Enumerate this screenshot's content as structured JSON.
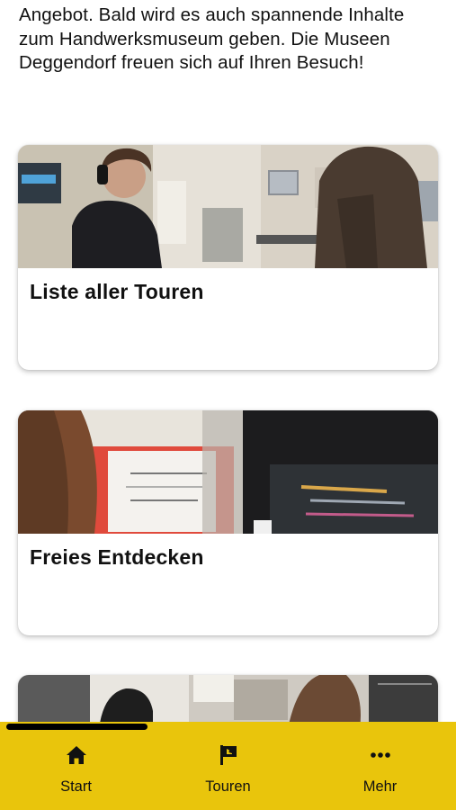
{
  "intro": {
    "text": "Angebot. Bald wird es auch spannende Inhalte zum Handwerksmuseum geben. Die Museen Deggendorf freuen sich auf Ihren Besuch!"
  },
  "cards": [
    {
      "title": "Liste aller Touren",
      "image": "museum-visitor-with-headphones-photo"
    },
    {
      "title": "Freies Entdecken",
      "image": "deggendorf-exhibit-display-case-photo"
    },
    {
      "title": "",
      "image": "museum-visitors-photo"
    }
  ],
  "tabbar": {
    "background": "#e9c50c",
    "items": [
      {
        "label": "Start",
        "icon": "home-icon"
      },
      {
        "label": "Touren",
        "icon": "flag-icon"
      },
      {
        "label": "Mehr",
        "icon": "more-dots-icon"
      }
    ]
  }
}
